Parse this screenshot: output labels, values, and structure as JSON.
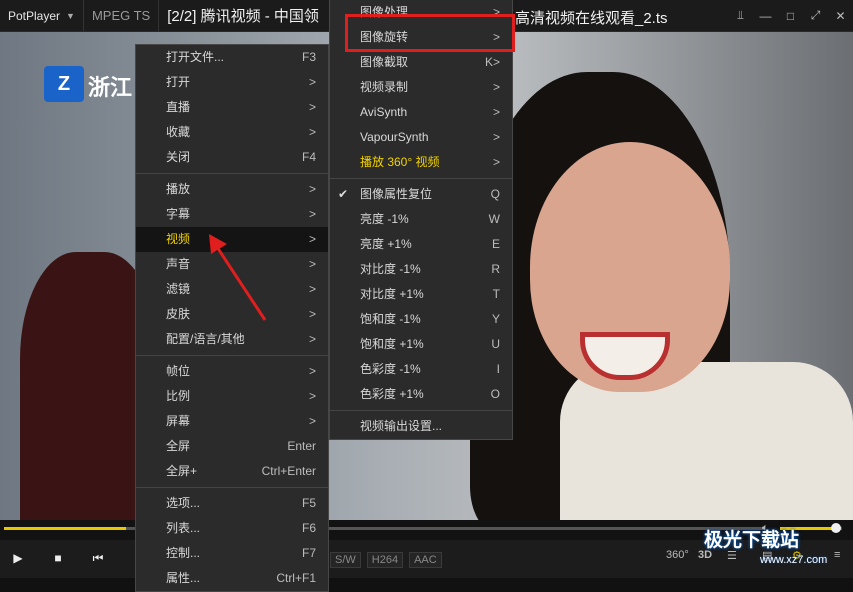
{
  "titlebar": {
    "app_name": "PotPlayer",
    "app_dropdown_icon": "chevron-down-icon",
    "codec": "MPEG TS",
    "title_left": "[2/2] 腾讯视频 - 中国领",
    "title_right": "高清视频在线观看_2.ts",
    "controls": [
      "pin-icon",
      "minimize-icon",
      "maximize-icon",
      "fullscreen-icon",
      "close-icon"
    ]
  },
  "video": {
    "logo_text": "浙江"
  },
  "main_menu": [
    {
      "label": "打开文件...",
      "shortcut": "F3"
    },
    {
      "label": "打开",
      "shortcut": ">"
    },
    {
      "label": "直播",
      "shortcut": ">"
    },
    {
      "label": "收藏",
      "shortcut": ">"
    },
    {
      "label": "关闭",
      "shortcut": "F4"
    },
    {
      "separator": true
    },
    {
      "label": "播放",
      "shortcut": ">"
    },
    {
      "label": "字幕",
      "shortcut": ">"
    },
    {
      "label": "视频",
      "shortcut": ">",
      "highlighted": true
    },
    {
      "label": "声音",
      "shortcut": ">"
    },
    {
      "label": "滤镜",
      "shortcut": ">"
    },
    {
      "label": "皮肤",
      "shortcut": ">"
    },
    {
      "label": "配置/语言/其他",
      "shortcut": ">"
    },
    {
      "separator": true
    },
    {
      "label": "帧位",
      "shortcut": ">"
    },
    {
      "label": "比例",
      "shortcut": ">"
    },
    {
      "label": "屏幕",
      "shortcut": ">"
    },
    {
      "label": "全屏",
      "shortcut": "Enter"
    },
    {
      "label": "全屏+",
      "shortcut": "Ctrl+Enter"
    },
    {
      "separator": true
    },
    {
      "label": "选项...",
      "shortcut": "F5"
    },
    {
      "label": "列表...",
      "shortcut": "F6"
    },
    {
      "label": "控制...",
      "shortcut": "F7"
    },
    {
      "label": "属性...",
      "shortcut": "Ctrl+F1"
    }
  ],
  "video_submenu": [
    {
      "label": "图像处理",
      "shortcut": ">"
    },
    {
      "label": "图像旋转",
      "shortcut": ">"
    },
    {
      "label": "图像截取",
      "shortcut": "K>"
    },
    {
      "label": "视频录制",
      "shortcut": ">"
    },
    {
      "label": "AviSynth",
      "shortcut": ">"
    },
    {
      "label": "VapourSynth",
      "shortcut": ">"
    },
    {
      "label": "播放 360° 视频",
      "shortcut": ">",
      "yellow": true
    },
    {
      "separator": true
    },
    {
      "label": "图像属性复位",
      "shortcut": "Q",
      "checked": true
    },
    {
      "label": "亮度 -1%",
      "shortcut": "W"
    },
    {
      "label": "亮度 +1%",
      "shortcut": "E"
    },
    {
      "label": "对比度 -1%",
      "shortcut": "R"
    },
    {
      "label": "对比度 +1%",
      "shortcut": "T"
    },
    {
      "label": "饱和度 -1%",
      "shortcut": "Y"
    },
    {
      "label": "饱和度 +1%",
      "shortcut": "U"
    },
    {
      "label": "色彩度 -1%",
      "shortcut": "I"
    },
    {
      "label": "色彩度 +1%",
      "shortcut": "O"
    },
    {
      "separator": true
    },
    {
      "label": "视频输出设置...",
      "shortcut": ""
    }
  ],
  "seek": {
    "progress": 0.16
  },
  "volume": {
    "level": 0.9,
    "icon": "speaker-icon"
  },
  "controls": {
    "buttons": [
      "play-icon",
      "stop-icon",
      "previous-icon"
    ],
    "tags": [
      "S/W",
      "H264",
      "AAC"
    ],
    "right_icons": [
      "360-icon",
      "3d-icon",
      "equalizer-icon",
      "subtitle-icon",
      "settings-gear-icon",
      "menu-icon"
    ],
    "label_360": "360°",
    "label_3d": "3D"
  },
  "watermark": {
    "text": "极光下载站",
    "sub": "www.xz7.com"
  },
  "colors": {
    "accent_yellow": "#f2d200",
    "highlight_box": "#e01e1e",
    "menu_bg": "#2b2b2b"
  }
}
